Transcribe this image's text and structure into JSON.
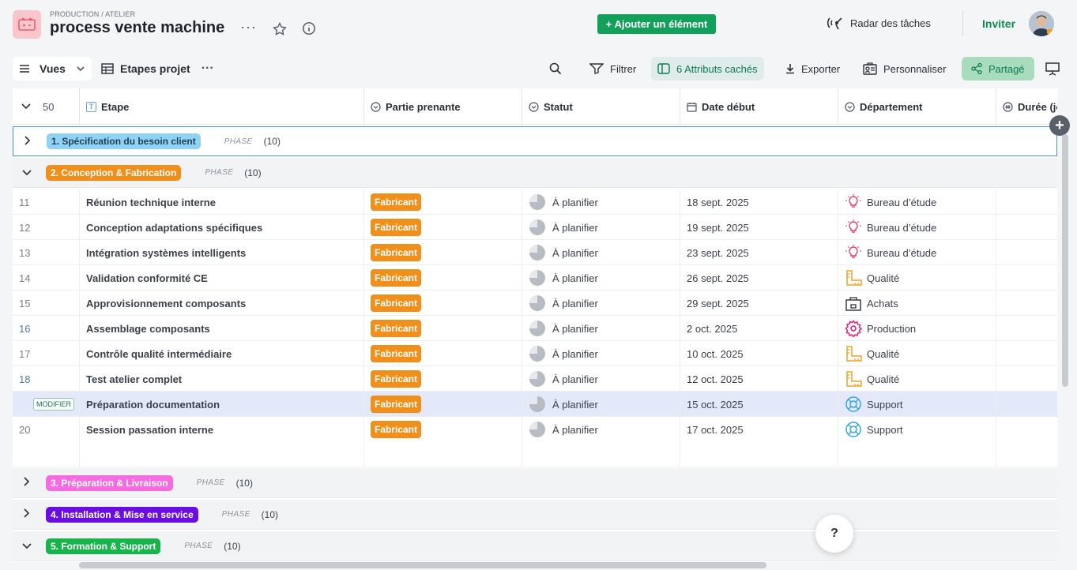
{
  "header": {
    "breadcrumb": "PRODUCTION / ATELIER",
    "title": "process vente machine",
    "more": "···",
    "add_button": "+ Ajouter un élément",
    "radar": "Radar des tâches",
    "invite": "Inviter"
  },
  "toolbar": {
    "views": "Vues",
    "view_name": "Etapes projet",
    "more": "···",
    "filter": "Filtrer",
    "hidden_attributes": "6 Attributs cachés",
    "export": "Exporter",
    "customize": "Personnaliser",
    "share": "Partagé"
  },
  "table": {
    "row_count": "50",
    "columns": [
      "Etape",
      "Partie prenante",
      "Statut",
      "Date début",
      "Département",
      "Durée (jou"
    ],
    "groups": [
      {
        "label": "1. Spécification du besoin client",
        "color": "#8ed2f4",
        "text_color": "#1f3d57",
        "phase": "PHASE",
        "count": "(10)"
      },
      {
        "label": "2. Conception & Fabrication",
        "color": "#f0901b",
        "text_color": "#ffffff",
        "phase": "PHASE",
        "count": "(10)"
      },
      {
        "label": "3. Préparation & Livraison",
        "color": "#f56be0",
        "text_color": "#ffffff",
        "phase": "PHASE",
        "count": "(10)"
      },
      {
        "label": "4. Installation & Mise en service",
        "color": "#6a0de0",
        "text_color": "#ffffff",
        "phase": "PHASE",
        "count": "(10)"
      },
      {
        "label": "5. Formation & Support",
        "color": "#19b34c",
        "text_color": "#ffffff",
        "phase": "PHASE",
        "count": "(10)"
      }
    ],
    "rows": [
      {
        "num": "11",
        "step": "Réunion technique interne",
        "party": "Fabricant",
        "status": "À planifier",
        "date": "18 sept. 2025",
        "dept": "Bureau d’étude",
        "dept_icon": "bulb-icon"
      },
      {
        "num": "12",
        "step": "Conception adaptations spécifiques",
        "party": "Fabricant",
        "status": "À planifier",
        "date": "19 sept. 2025",
        "dept": "Bureau d’étude",
        "dept_icon": "bulb-icon"
      },
      {
        "num": "13",
        "step": "Intégration systèmes intelligents",
        "party": "Fabricant",
        "status": "À planifier",
        "date": "23 sept. 2025",
        "dept": "Bureau d’étude",
        "dept_icon": "bulb-icon"
      },
      {
        "num": "14",
        "step": "Validation conformité CE",
        "party": "Fabricant",
        "status": "À planifier",
        "date": "26 sept. 2025",
        "dept": "Qualité",
        "dept_icon": "ruler-icon"
      },
      {
        "num": "15",
        "step": "Approvisionnement composants",
        "party": "Fabricant",
        "status": "À planifier",
        "date": "29 sept. 2025",
        "dept": "Achats",
        "dept_icon": "shopping-bag-icon"
      },
      {
        "num": "16",
        "step": "Assemblage composants",
        "party": "Fabricant",
        "status": "À planifier",
        "date": "2 oct. 2025",
        "dept": "Production",
        "dept_icon": "gear-icon"
      },
      {
        "num": "17",
        "step": "Contrôle qualité intermédiaire",
        "party": "Fabricant",
        "status": "À planifier",
        "date": "10 oct. 2025",
        "dept": "Qualité",
        "dept_icon": "ruler-icon"
      },
      {
        "num": "18",
        "step": "Test atelier complet",
        "party": "Fabricant",
        "status": "À planifier",
        "date": "12 oct. 2025",
        "dept": "Qualité",
        "dept_icon": "ruler-icon"
      },
      {
        "num": "MODIFIER",
        "step": "Préparation documentation",
        "party": "Fabricant",
        "status": "À planifier",
        "date": "15 oct. 2025",
        "dept": "Support",
        "dept_icon": "lifebuoy-icon"
      },
      {
        "num": "20",
        "step": "Session passation interne",
        "party": "Fabricant",
        "status": "À planifier",
        "date": "17 oct. 2025",
        "dept": "Support",
        "dept_icon": "lifebuoy-icon"
      }
    ]
  },
  "help": "?"
}
